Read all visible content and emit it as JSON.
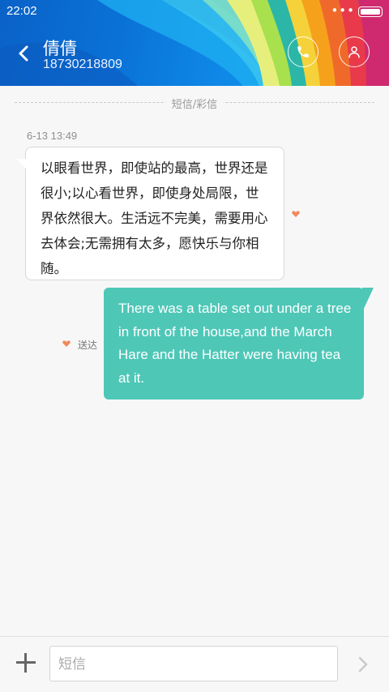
{
  "status_bar": {
    "time": "22:02",
    "dots": "•••"
  },
  "header": {
    "contact_name": "倩倩",
    "contact_number": "18730218809"
  },
  "conversation": {
    "type_label": "短信/彩信",
    "timestamp": "6-13 13:49",
    "messages": [
      {
        "direction": "incoming",
        "text": "以眼看世界，即使站的最高，世界还是很小;以心看世界，即使身处局限，世界依然很大。生活远不完美，需要用心去体会;无需拥有太多，愿快乐与你相随。"
      },
      {
        "direction": "outgoing",
        "text": "There was a table set out under a tree in front of the house,and the March Hare and the Hatter were having tea at it.",
        "status": "送达"
      }
    ]
  },
  "composer": {
    "placeholder": "短信"
  },
  "colors": {
    "accent": "#4ec7b7",
    "header_blue": "#0a71d6",
    "heart": "#f08a5d"
  }
}
